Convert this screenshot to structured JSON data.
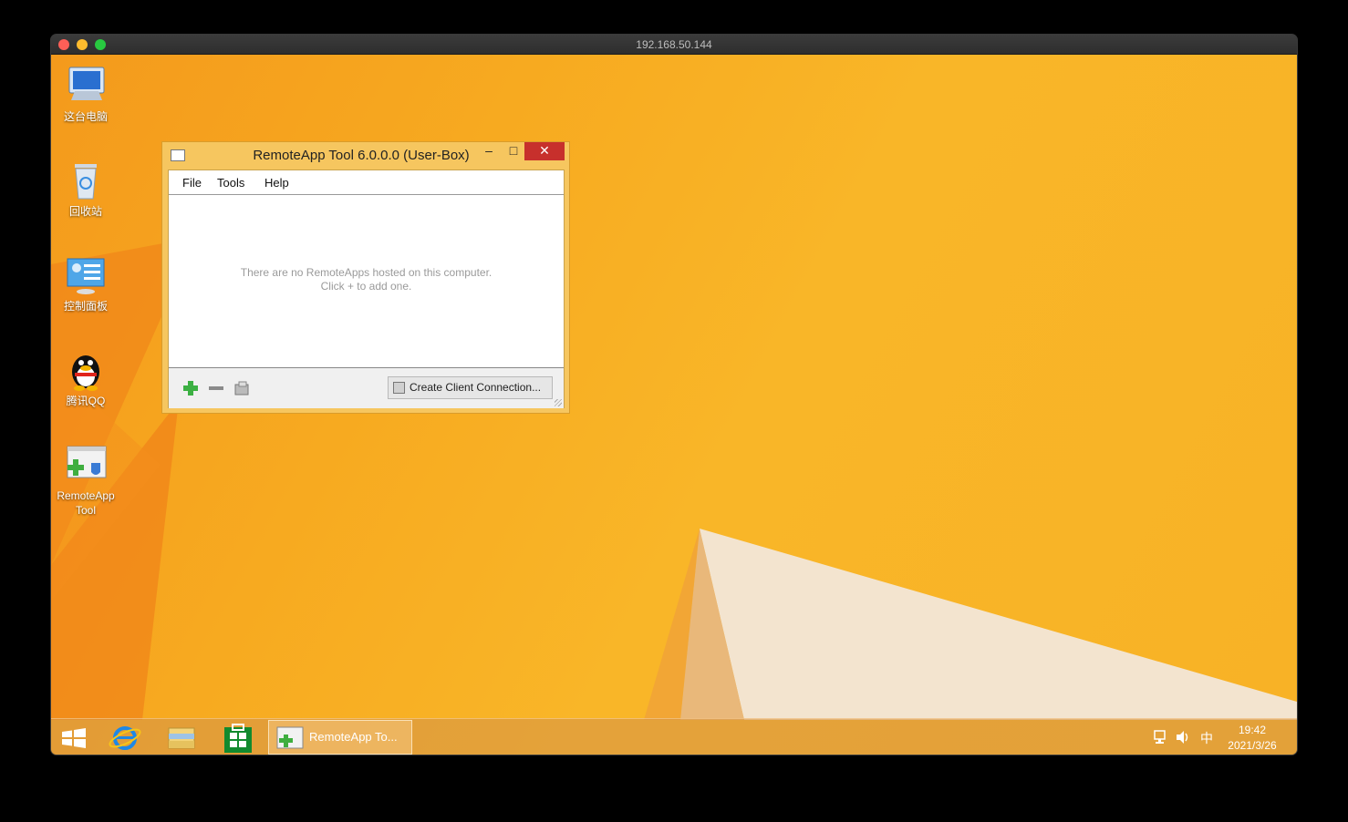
{
  "mac_window": {
    "title": "192.168.50.144"
  },
  "desktop_icons": [
    {
      "label": "这台电脑"
    },
    {
      "label": "回收站"
    },
    {
      "label": "控制面板"
    },
    {
      "label": "腾讯QQ"
    },
    {
      "label": "RemoteApp Tool"
    }
  ],
  "app_window": {
    "title": "RemoteApp Tool 6.0.0.0 (User-Box)",
    "minimize_glyph": "–",
    "maximize_glyph": "□",
    "close_glyph": "✕",
    "menu": {
      "file": "File",
      "tools": "Tools",
      "help": "Help"
    },
    "empty_message_line1": "There are no RemoteApps hosted on this computer.",
    "empty_message_line2": "Click + to add one.",
    "create_connection_label": "Create Client Connection..."
  },
  "taskbar": {
    "active_task_label": "RemoteApp To...",
    "tray_ime": "中",
    "clock_time": "19:42",
    "clock_date": "2021/3/26"
  },
  "colors": {
    "accent_orange": "#f7aa20",
    "close_red": "#c7302c"
  }
}
